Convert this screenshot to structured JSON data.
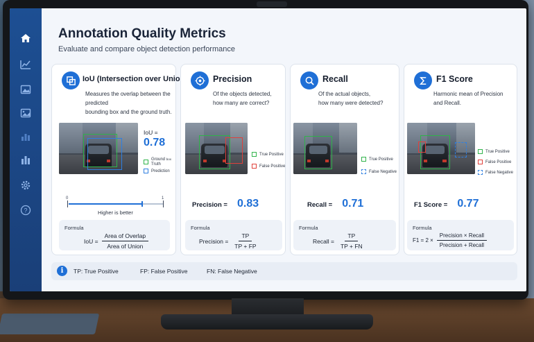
{
  "colors": {
    "accent": "#1f6fd6",
    "sidebar": "#1d4f93",
    "true_positive": "#2fb34a",
    "false_positive": "#e0403a",
    "ground_truth": "#2fb34a",
    "prediction": "#2f7fe0"
  },
  "sidebar": {
    "items": [
      {
        "icon": "home-icon",
        "active": true
      },
      {
        "icon": "line-chart-icon",
        "active": false
      },
      {
        "icon": "image-icon",
        "active": false
      },
      {
        "icon": "gallery-icon",
        "active": false
      },
      {
        "icon": "bar-chart-icon",
        "active": false
      },
      {
        "icon": "analytics-icon",
        "active": false
      },
      {
        "icon": "gear-icon",
        "active": false
      },
      {
        "icon": "help-icon",
        "active": false
      }
    ]
  },
  "header": {
    "title": "Annotation Quality Metrics",
    "subtitle": "Evaluate and compare object detection performance"
  },
  "cards": {
    "iou": {
      "icon": "overlap-icon",
      "title": "IoU (Intersection over Union)",
      "desc_line1": "Measures the overlap between the predicted",
      "desc_line2": "bounding box and the ground truth.",
      "metric_label": "IoU =",
      "metric_value": "0.78",
      "legend_ground_truth_1": "Ground",
      "legend_ground_truth_2": "Truth",
      "legend_ground_truth_suffix": "box",
      "legend_prediction": "Prediction",
      "slider_min": "0",
      "slider_max": "1",
      "slider_level": 0.78,
      "slider_caption": "Higher is better",
      "formula_label": "Formula",
      "formula_lhs": "IoU =",
      "formula_num": "Area of Overlap",
      "formula_den": "Area of Union"
    },
    "precision": {
      "icon": "target-icon",
      "title": "Precision",
      "desc_line1": "Of the objects detected,",
      "desc_line2": "how many are correct?",
      "legend_tp": "True Positive",
      "legend_fp": "False Positive",
      "metric_label": "Precision =",
      "metric_value": "0.83",
      "formula_label": "Formula",
      "formula_lhs": "Precision =",
      "formula_num": "TP",
      "formula_den": "TP + FP"
    },
    "recall": {
      "icon": "search-icon",
      "title": "Recall",
      "desc_line1": "Of the actual objects,",
      "desc_line2": "how many were detected?",
      "legend_tp": "True Positive",
      "legend_fn": "False Negative",
      "metric_label": "Recall =",
      "metric_value": "0.71",
      "formula_label": "Formula",
      "formula_lhs": "Recall =",
      "formula_num": "TP",
      "formula_den": "TP + FN"
    },
    "f1": {
      "icon": "sigma-icon",
      "title": "F1 Score",
      "desc_line1": "Harmonic mean of Precision",
      "desc_line2": "and Recall.",
      "legend_tp": "True Positive",
      "legend_fp": "False Positive",
      "legend_fn": "False Negative",
      "metric_label": "F1 Score =",
      "metric_value": "0.77",
      "formula_label": "Formula",
      "formula_lhs": "F1 = 2 ×",
      "formula_num": "Precision × Recall",
      "formula_den": "Precision + Recall"
    }
  },
  "footer": {
    "tp": "TP: True Positive",
    "fp": "FP: False Positive",
    "fn": "FN: False Negative"
  }
}
